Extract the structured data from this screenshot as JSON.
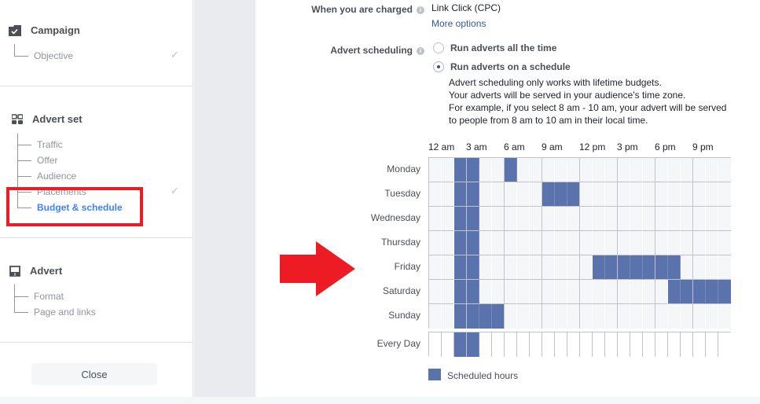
{
  "sidebar": {
    "sections": [
      {
        "title": "Campaign",
        "icon": "checkbox-folder-icon",
        "items": [
          {
            "label": "Objective",
            "completed": true
          }
        ]
      },
      {
        "title": "Advert set",
        "icon": "grid-icon",
        "items": [
          {
            "label": "Traffic",
            "completed": false
          },
          {
            "label": "Offer",
            "completed": false
          },
          {
            "label": "Audience",
            "completed": false
          },
          {
            "label": "Placements",
            "completed": true
          },
          {
            "label": "Budget & schedule",
            "completed": false,
            "active": true
          }
        ]
      },
      {
        "title": "Advert",
        "icon": "advert-layout-icon",
        "items": [
          {
            "label": "Format",
            "completed": false
          },
          {
            "label": "Page and links",
            "completed": false
          }
        ]
      }
    ],
    "close_label": "Close"
  },
  "form": {
    "charged": {
      "label": "When you are charged",
      "value": "Link Click (CPC)",
      "more_options": "More options"
    },
    "scheduling": {
      "label": "Advert scheduling",
      "options": [
        {
          "label": "Run adverts all the time",
          "selected": false
        },
        {
          "label": "Run adverts on a schedule",
          "selected": true
        }
      ],
      "description": [
        "Advert scheduling only works with lifetime budgets.",
        "Your adverts will be served in your audience's time zone.",
        "For example, if you select 8 am - 10 am, your advert will be served",
        "to people from 8 am to 10 am in their local time."
      ]
    }
  },
  "schedule": {
    "hour_labels": [
      "12 am",
      "3 am",
      "6 am",
      "9 am",
      "12 pm",
      "3 pm",
      "6 pm",
      "9 pm"
    ],
    "days": [
      {
        "name": "Monday",
        "hours": [
          2,
          3,
          6
        ]
      },
      {
        "name": "Tuesday",
        "hours": [
          2,
          3,
          9,
          10,
          11
        ]
      },
      {
        "name": "Wednesday",
        "hours": [
          2,
          3
        ]
      },
      {
        "name": "Thursday",
        "hours": [
          2,
          3
        ]
      },
      {
        "name": "Friday",
        "hours": [
          2,
          3,
          13,
          14,
          15,
          16,
          17,
          18,
          19
        ]
      },
      {
        "name": "Saturday",
        "hours": [
          2,
          3,
          19,
          20,
          21,
          22,
          23
        ]
      },
      {
        "name": "Sunday",
        "hours": [
          2,
          3,
          4,
          5
        ]
      }
    ],
    "every_day": {
      "name": "Every Day",
      "hours": [
        2,
        3
      ]
    },
    "legend": "Scheduled hours",
    "colors": {
      "scheduled": "#5b73ad",
      "empty": "#f5f6f7",
      "grid_line": "#bec2c9"
    }
  },
  "annotation": {
    "highlight_color": "#ed1c24"
  }
}
